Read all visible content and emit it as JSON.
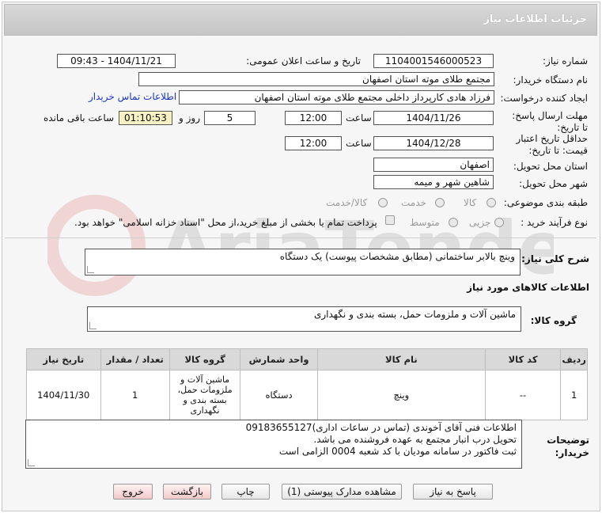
{
  "header": {
    "title": "جزئیات اطلاعات نیاز"
  },
  "fields": {
    "need_number": {
      "label": "شماره نیاز:",
      "value": "1104001546000523"
    },
    "announce_date": {
      "label": "تاریخ و ساعت اعلان عمومی:",
      "value": "1404/11/21 - 09:43"
    },
    "buyer_org": {
      "label": "نام دستگاه خریدار:",
      "value": "مجتمع طلای موته استان اصفهان"
    },
    "requester": {
      "label": "ایجاد کننده درخواست:",
      "value": "فرزاد هادی کارپرداز داخلی مجتمع طلای موته استان اصفهان",
      "contact_link": "اطلاعات تماس خریدار"
    },
    "reply_deadline": {
      "label": "مهلت ارسال پاسخ: تا تاریخ:",
      "date": "1404/11/26",
      "time_label": "ساعت",
      "time": "12:00",
      "days": "5",
      "days_label": "روز و",
      "remaining": "01:10:53",
      "remaining_label": "ساعت باقی مانده"
    },
    "price_validity": {
      "label": "حداقل تاریخ اعتبار قیمت: تا تاریخ:",
      "date": "1404/12/28",
      "time_label": "ساعت",
      "time": "12:00"
    },
    "delivery_province": {
      "label": "استان محل تحویل:",
      "value": "اصفهان"
    },
    "delivery_city": {
      "label": "شهر محل تحویل:",
      "value": "شاهین شهر و میمه"
    },
    "category": {
      "label": "طبقه بندی موضوعی:",
      "options": [
        "کالا",
        "خدمت",
        "کالا/خدمت"
      ]
    },
    "process_type": {
      "label": "نوع فرآیند خرید :",
      "options": [
        "جزیی",
        "متوسط"
      ],
      "payment_note": "پرداخت تمام یا بخشی از مبلغ خرید،از محل \"اسناد خزانه اسلامی\" خواهد بود."
    }
  },
  "description": {
    "label": "شرح کلی نیاز:",
    "value": "وینچ بالابر ساختمانی (مطابق مشخصات پیوست) یک دستگاه"
  },
  "goods_section": {
    "title": "اطلاعات کالاهای مورد نیاز",
    "group_label": "گروه کالا:",
    "group_value": "ماشین آلات و ملزومات حمل، بسته بندی و نگهداری"
  },
  "table": {
    "headers": [
      "ردیف",
      "کد کالا",
      "نام کالا",
      "واحد شمارش",
      "گروه کالا",
      "تعداد / مقدار",
      "تاریخ نیاز"
    ],
    "rows": [
      {
        "row": "1",
        "code": "--",
        "name": "وینچ",
        "unit": "دستگاه",
        "group": "ماشین آلات و ملزومات حمل، بسته بندی و نگهداری",
        "qty": "1",
        "date": "1404/11/30"
      }
    ]
  },
  "buyer_notes": {
    "label": "توضیحات خریدار:",
    "lines": [
      "اطلاعات فنی آقای آخوندی (تماس در ساعات اداری)09183655127",
      "تحویل درب انبار مجتمع به عهده فروشنده می باشد.",
      "ثبت فاکتور در سامانه مودیان با کد شعبه 0004 الزامی است"
    ]
  },
  "buttons": {
    "reply": "پاسخ به نیاز",
    "attachments": "مشاهده مدارک پیوستی (1)",
    "print": "چاپ",
    "back": "بازگشت",
    "exit": "خروج"
  },
  "watermark": {
    "text": "AriaTender.net"
  },
  "colors": {
    "link": "#1a35c7",
    "remaining_bg": "#f7f0c2",
    "header_bg": "#cccccc",
    "pink_button": "#f3c9c9"
  }
}
